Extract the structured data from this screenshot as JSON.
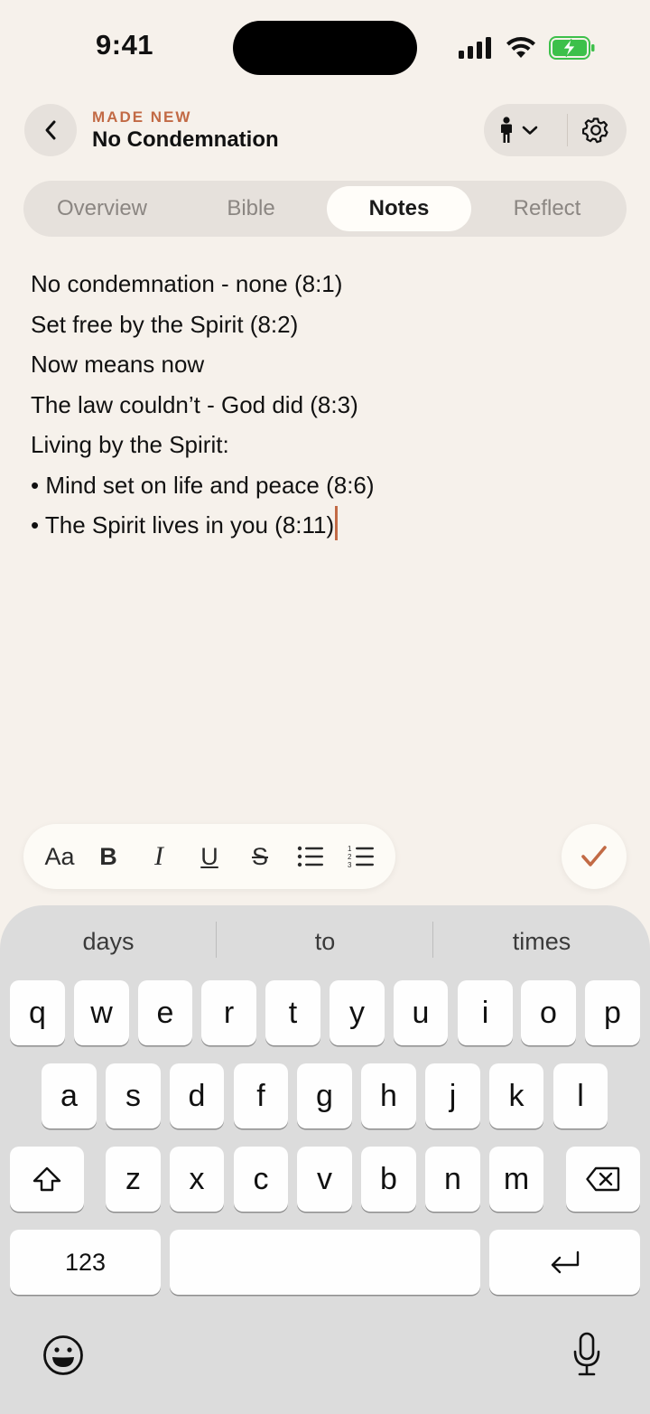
{
  "status_bar": {
    "time": "9:41"
  },
  "header": {
    "kicker": "MADE NEW",
    "title": "No Condemnation"
  },
  "tabs": [
    {
      "label": "Overview"
    },
    {
      "label": "Bible"
    },
    {
      "label": "Notes"
    },
    {
      "label": "Reflect"
    }
  ],
  "active_tab": "Notes",
  "notes": {
    "lines": [
      "No condemnation - none (8:1)",
      "Set free by the Spirit (8:2)",
      "Now means now",
      "The law couldn’t - God did (8:3)",
      "Living by the Spirit:",
      "• Mind set on life and peace (8:6)",
      "• The Spirit lives in you (8:11)"
    ]
  },
  "format_toolbar": {
    "text_style_label": "Aa",
    "bold_label": "B",
    "italic_label": "I",
    "underline_label": "U",
    "strike_label": "S"
  },
  "keyboard": {
    "suggestions": [
      "days",
      "to",
      "times"
    ],
    "row1": [
      "q",
      "w",
      "e",
      "r",
      "t",
      "y",
      "u",
      "i",
      "o",
      "p"
    ],
    "row2": [
      "a",
      "s",
      "d",
      "f",
      "g",
      "h",
      "j",
      "k",
      "l"
    ],
    "row3": [
      "z",
      "x",
      "c",
      "v",
      "b",
      "n",
      "m"
    ],
    "numbers_label": "123"
  },
  "colors": {
    "accent": "#c26a45",
    "background": "#f6f1eb",
    "battery_green": "#3dc04a"
  }
}
